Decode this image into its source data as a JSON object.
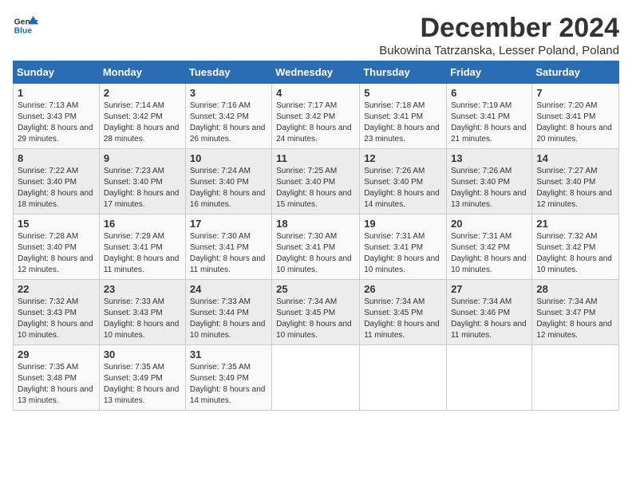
{
  "logo": {
    "text_general": "General",
    "text_blue": "Blue"
  },
  "title": "December 2024",
  "subtitle": "Bukowina Tatrzanska, Lesser Poland, Poland",
  "headers": [
    "Sunday",
    "Monday",
    "Tuesday",
    "Wednesday",
    "Thursday",
    "Friday",
    "Saturday"
  ],
  "weeks": [
    [
      {
        "day": "1",
        "sunrise": "7:13 AM",
        "sunset": "3:43 PM",
        "daylight": "8 hours and 29 minutes."
      },
      {
        "day": "2",
        "sunrise": "7:14 AM",
        "sunset": "3:42 PM",
        "daylight": "8 hours and 28 minutes."
      },
      {
        "day": "3",
        "sunrise": "7:16 AM",
        "sunset": "3:42 PM",
        "daylight": "8 hours and 26 minutes."
      },
      {
        "day": "4",
        "sunrise": "7:17 AM",
        "sunset": "3:42 PM",
        "daylight": "8 hours and 24 minutes."
      },
      {
        "day": "5",
        "sunrise": "7:18 AM",
        "sunset": "3:41 PM",
        "daylight": "8 hours and 23 minutes."
      },
      {
        "day": "6",
        "sunrise": "7:19 AM",
        "sunset": "3:41 PM",
        "daylight": "8 hours and 21 minutes."
      },
      {
        "day": "7",
        "sunrise": "7:20 AM",
        "sunset": "3:41 PM",
        "daylight": "8 hours and 20 minutes."
      }
    ],
    [
      {
        "day": "8",
        "sunrise": "7:22 AM",
        "sunset": "3:40 PM",
        "daylight": "8 hours and 18 minutes."
      },
      {
        "day": "9",
        "sunrise": "7:23 AM",
        "sunset": "3:40 PM",
        "daylight": "8 hours and 17 minutes."
      },
      {
        "day": "10",
        "sunrise": "7:24 AM",
        "sunset": "3:40 PM",
        "daylight": "8 hours and 16 minutes."
      },
      {
        "day": "11",
        "sunrise": "7:25 AM",
        "sunset": "3:40 PM",
        "daylight": "8 hours and 15 minutes."
      },
      {
        "day": "12",
        "sunrise": "7:26 AM",
        "sunset": "3:40 PM",
        "daylight": "8 hours and 14 minutes."
      },
      {
        "day": "13",
        "sunrise": "7:26 AM",
        "sunset": "3:40 PM",
        "daylight": "8 hours and 13 minutes."
      },
      {
        "day": "14",
        "sunrise": "7:27 AM",
        "sunset": "3:40 PM",
        "daylight": "8 hours and 12 minutes."
      }
    ],
    [
      {
        "day": "15",
        "sunrise": "7:28 AM",
        "sunset": "3:40 PM",
        "daylight": "8 hours and 12 minutes."
      },
      {
        "day": "16",
        "sunrise": "7:29 AM",
        "sunset": "3:41 PM",
        "daylight": "8 hours and 11 minutes."
      },
      {
        "day": "17",
        "sunrise": "7:30 AM",
        "sunset": "3:41 PM",
        "daylight": "8 hours and 11 minutes."
      },
      {
        "day": "18",
        "sunrise": "7:30 AM",
        "sunset": "3:41 PM",
        "daylight": "8 hours and 10 minutes."
      },
      {
        "day": "19",
        "sunrise": "7:31 AM",
        "sunset": "3:41 PM",
        "daylight": "8 hours and 10 minutes."
      },
      {
        "day": "20",
        "sunrise": "7:31 AM",
        "sunset": "3:42 PM",
        "daylight": "8 hours and 10 minutes."
      },
      {
        "day": "21",
        "sunrise": "7:32 AM",
        "sunset": "3:42 PM",
        "daylight": "8 hours and 10 minutes."
      }
    ],
    [
      {
        "day": "22",
        "sunrise": "7:32 AM",
        "sunset": "3:43 PM",
        "daylight": "8 hours and 10 minutes."
      },
      {
        "day": "23",
        "sunrise": "7:33 AM",
        "sunset": "3:43 PM",
        "daylight": "8 hours and 10 minutes."
      },
      {
        "day": "24",
        "sunrise": "7:33 AM",
        "sunset": "3:44 PM",
        "daylight": "8 hours and 10 minutes."
      },
      {
        "day": "25",
        "sunrise": "7:34 AM",
        "sunset": "3:45 PM",
        "daylight": "8 hours and 10 minutes."
      },
      {
        "day": "26",
        "sunrise": "7:34 AM",
        "sunset": "3:45 PM",
        "daylight": "8 hours and 11 minutes."
      },
      {
        "day": "27",
        "sunrise": "7:34 AM",
        "sunset": "3:46 PM",
        "daylight": "8 hours and 11 minutes."
      },
      {
        "day": "28",
        "sunrise": "7:34 AM",
        "sunset": "3:47 PM",
        "daylight": "8 hours and 12 minutes."
      }
    ],
    [
      {
        "day": "29",
        "sunrise": "7:35 AM",
        "sunset": "3:48 PM",
        "daylight": "8 hours and 13 minutes."
      },
      {
        "day": "30",
        "sunrise": "7:35 AM",
        "sunset": "3:49 PM",
        "daylight": "8 hours and 13 minutes."
      },
      {
        "day": "31",
        "sunrise": "7:35 AM",
        "sunset": "3:49 PM",
        "daylight": "8 hours and 14 minutes."
      },
      null,
      null,
      null,
      null
    ]
  ]
}
